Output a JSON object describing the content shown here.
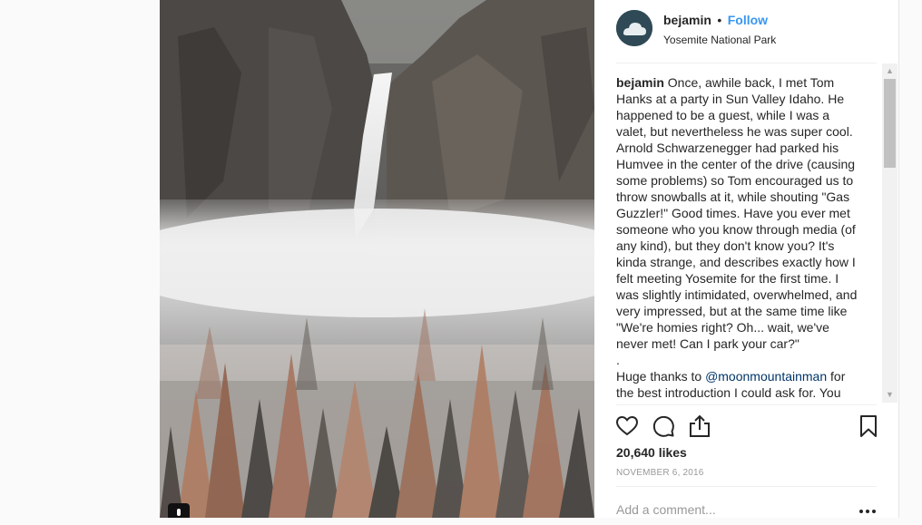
{
  "post": {
    "username": "bejamin",
    "separator": "•",
    "follow_label": "Follow",
    "location": "Yosemite National Park",
    "caption_username": "bejamin",
    "caption_lines": [
      "Once, awhile back, I met Tom Hanks at a party in Sun Valley Idaho. He happened to be a guest, while I was a valet, but nevertheless he was super cool. Arnold Schwarzenegger had parked his Humvee in the center of the drive (causing some problems) so Tom encouraged us to throw snowballs at it, while shouting \"Gas Guzzler!\" Good times. Have you ever met someone who you know through media (of any kind), but they don't know you? It's kinda strange, and describes exactly how I felt meeting Yosemite for the first time. I was slightly intimidated, overwhelmed, and very impressed, but at the same time like \"We're homies right? Oh... wait, we've never met! Can I park your car?\"",
      ".",
      "Huge thanks to",
      "@moonmountainman",
      "for the best introduction I could ask for. You"
    ],
    "likes": "20,640 likes",
    "date": "NOVEMBER 6, 2016",
    "comment_placeholder": "Add a comment...",
    "scroll_up": "▲",
    "scroll_down": "▼"
  },
  "icons": {
    "like": "heart-icon",
    "comment": "comment-icon",
    "share": "share-icon",
    "save": "bookmark-icon",
    "more": "more-options-icon",
    "avatar": "cloud-avatar",
    "badge": "user-tag-icon"
  },
  "colors": {
    "follow": "#3897f0",
    "text": "#262626",
    "muted": "#999999",
    "mention": "#003569"
  }
}
